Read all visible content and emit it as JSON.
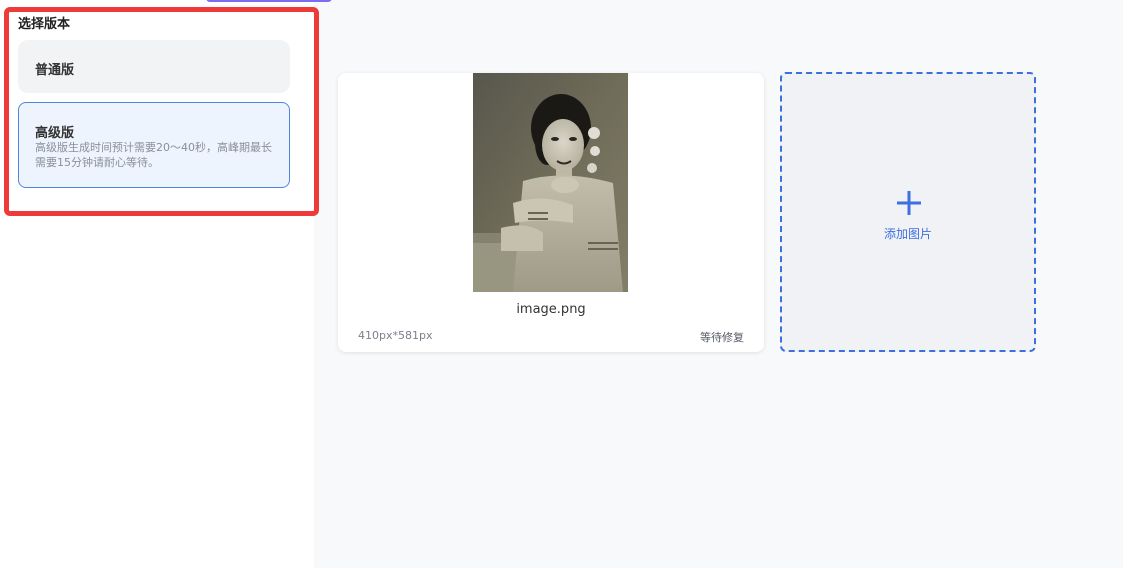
{
  "version_panel": {
    "title": "选择版本",
    "basic": {
      "label": "普通版"
    },
    "premium": {
      "label": "高级版",
      "description": "高级版生成时间预计需要20～40秒，高峰期最长需要15分钟请耐心等待。"
    }
  },
  "upload": {
    "file_name": "image.png",
    "dimensions": "410px*581px",
    "status": "等待修复"
  },
  "add_image": {
    "label": "添加图片"
  },
  "colors": {
    "accent": "#3c6fe0",
    "highlight_border": "#ef3a3a"
  },
  "icons": {
    "plus": "plus-icon"
  }
}
